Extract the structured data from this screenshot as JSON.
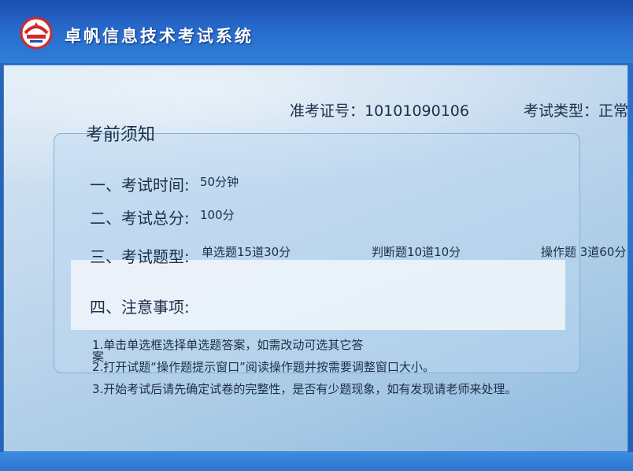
{
  "app": {
    "title": "卓帆信息技术考试系统",
    "logo_icon": "exam-system-logo-icon"
  },
  "candidate": {
    "ticket_label": "准考证号：10101090106",
    "exam_type_label": "考试类型：正常"
  },
  "notice": {
    "title": "考前须知",
    "time_label": "一、考试时间:",
    "time_value": "50分钟",
    "score_label": "二、考试总分:",
    "score_value": "100分",
    "types_label": "三、考试题型:",
    "type_single": "单选题15道30分",
    "type_judge": "判断题10道10分",
    "type_operate": "操作题 3道60分",
    "notes_label": "四、注意事项:",
    "rules": [
      "1.单击单选框选择单选题答案，如需改动可选其它答",
      "案",
      "2.打开试题“操作题提示窗口”阅读操作题并按需要调整窗口大小。",
      "3.开始考试后请先确定试卷的完整性，是否有少题现象，如有发现请老师来处理。"
    ]
  },
  "colors": {
    "title_bar": "#2a6fd0",
    "panel_bg": "#c3d9ee",
    "text": "#1c2f48"
  }
}
